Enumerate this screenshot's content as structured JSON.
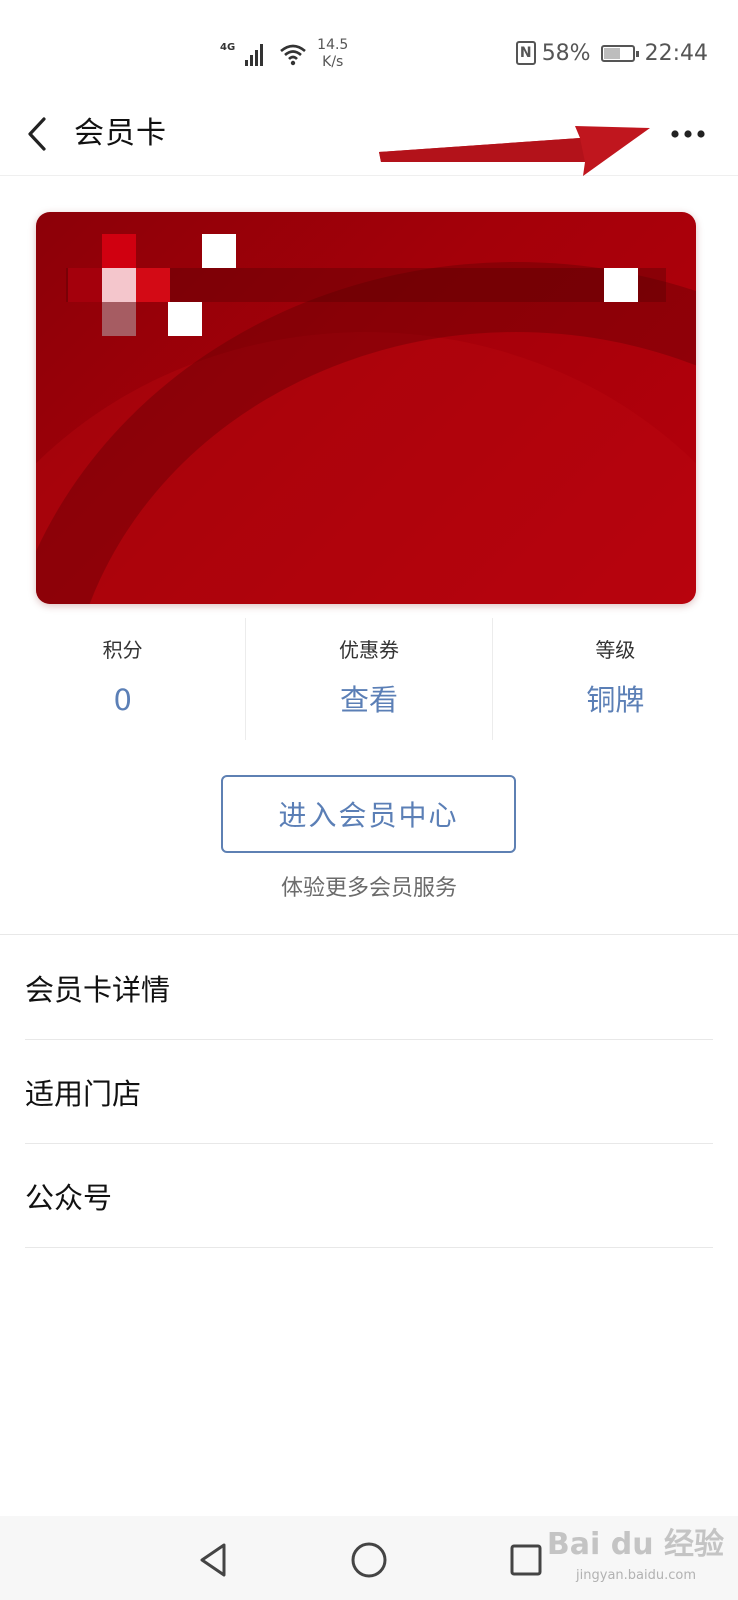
{
  "status_bar": {
    "network": "4G",
    "speed_value": "14.5",
    "speed_unit": "K/s",
    "nfc": "N",
    "battery": "58%",
    "battery_level": 0.58,
    "time": "22:44"
  },
  "header": {
    "back_icon": "chevron-left-icon",
    "title": "会员卡",
    "more_icon": "more-horizontal-icon"
  },
  "annotation": {
    "arrow_color": "#c0161e"
  },
  "card": {
    "color": "#a40009"
  },
  "stats": [
    {
      "label": "积分",
      "value": "0"
    },
    {
      "label": "优惠券",
      "value": "查看"
    },
    {
      "label": "等级",
      "value": "铜牌"
    }
  ],
  "member_center": {
    "button_label": "进入会员中心",
    "hint": "体验更多会员服务"
  },
  "menu": {
    "items": [
      {
        "label": "会员卡详情"
      },
      {
        "label": "适用门店"
      },
      {
        "label": "公众号"
      }
    ]
  },
  "nav": {
    "back_icon": "triangle-back-icon",
    "home_icon": "circle-home-icon",
    "recents_icon": "square-recents-icon"
  },
  "watermark": {
    "brand": "Bai du 经验",
    "url": "jingyan.baidu.com"
  },
  "colors": {
    "accent": "#5b7fb6",
    "card_red": "#a40009",
    "arrow_red": "#c0161e"
  }
}
